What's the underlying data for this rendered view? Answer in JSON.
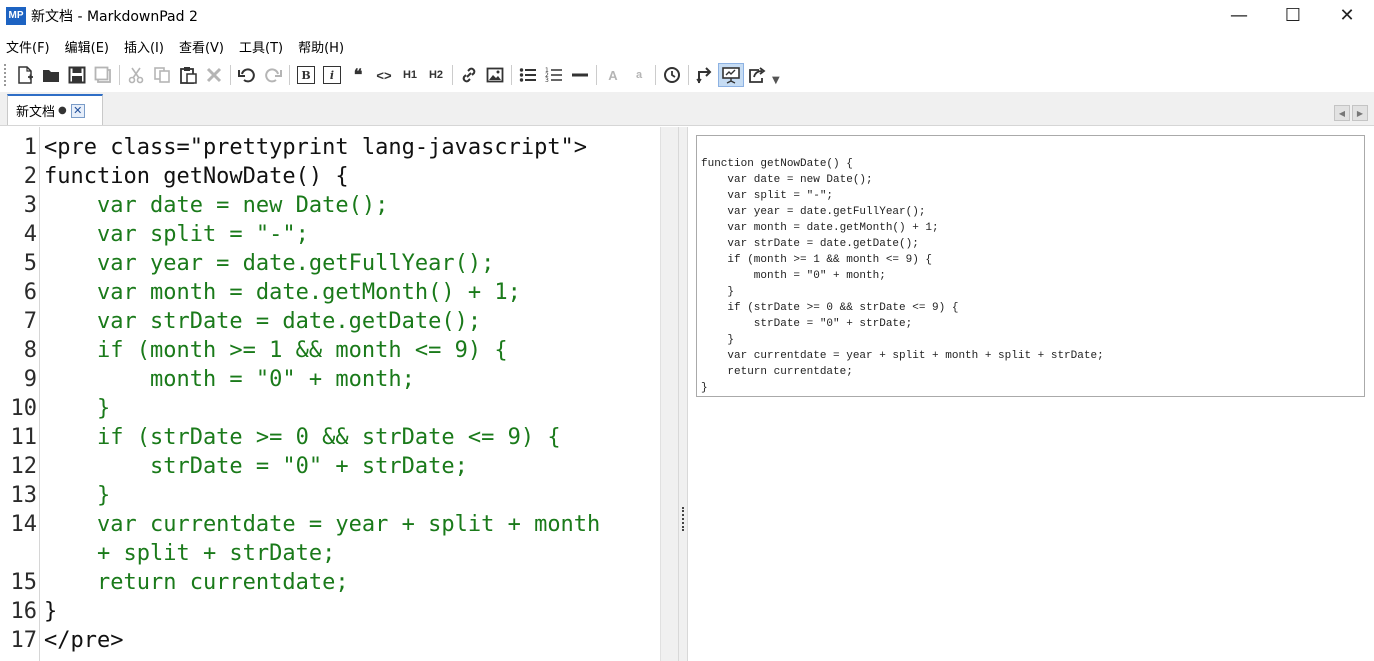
{
  "window": {
    "logo_text": "MP",
    "title": "新文档 - MarkdownPad 2",
    "minimize": "—",
    "maximize": "☐",
    "close": "✕"
  },
  "menu": {
    "items": [
      "文件(F)",
      "编辑(E)",
      "插入(I)",
      "查看(V)",
      "工具(T)",
      "帮助(H)"
    ]
  },
  "toolbar": {
    "blockquote": "❝",
    "code": "<>",
    "h1": "H1",
    "h2": "H2",
    "bold": "B",
    "italic": "i",
    "font_big": "A",
    "font_small": "a"
  },
  "tab": {
    "label": "新文档",
    "modified_mark": "●",
    "close": "✕"
  },
  "editor": {
    "lines": [
      {
        "n": "1",
        "text": "<pre class=\"prettyprint lang-javascript\">",
        "color": "#111111"
      },
      {
        "n": "2",
        "text": "function getNowDate() {",
        "color": "#111111"
      },
      {
        "n": "3",
        "text": "    var date = new Date();",
        "color": "#1a7a1a"
      },
      {
        "n": "4",
        "text": "    var split = \"-\";",
        "color": "#1a7a1a"
      },
      {
        "n": "5",
        "text": "    var year = date.getFullYear();",
        "color": "#1a7a1a"
      },
      {
        "n": "6",
        "text": "    var month = date.getMonth() + 1;",
        "color": "#1a7a1a"
      },
      {
        "n": "7",
        "text": "    var strDate = date.getDate();",
        "color": "#1a7a1a"
      },
      {
        "n": "8",
        "text": "    if (month >= 1 && month <= 9) {",
        "color": "#1a7a1a"
      },
      {
        "n": "9",
        "text": "        month = \"0\" + month;",
        "color": "#1a7a1a"
      },
      {
        "n": "10",
        "text": "    }",
        "color": "#1a7a1a"
      },
      {
        "n": "11",
        "text": "    if (strDate >= 0 && strDate <= 9) {",
        "color": "#1a7a1a"
      },
      {
        "n": "12",
        "text": "        strDate = \"0\" + strDate;",
        "color": "#1a7a1a"
      },
      {
        "n": "13",
        "text": "    }",
        "color": "#1a7a1a"
      },
      {
        "n": "14",
        "text": "    var currentdate = year + split + month",
        "color": "#1a7a1a"
      },
      {
        "n": "",
        "text": "    + split + strDate;",
        "color": "#1a7a1a"
      },
      {
        "n": "15",
        "text": "    return currentdate;",
        "color": "#1a7a1a"
      },
      {
        "n": "16",
        "text": "}",
        "color": "#111111"
      },
      {
        "n": "17",
        "text": "</pre>",
        "color": "#111111"
      }
    ]
  },
  "preview": {
    "code": "function getNowDate() {\n    var date = new Date();\n    var split = \"-\";\n    var year = date.getFullYear();\n    var month = date.getMonth() + 1;\n    var strDate = date.getDate();\n    if (month >= 1 && month <= 9) {\n        month = \"0\" + month;\n    }\n    if (strDate >= 0 && strDate <= 9) {\n        strDate = \"0\" + strDate;\n    }\n    var currentdate = year + split + month + split + strDate;\n    return currentdate;\n}"
  }
}
